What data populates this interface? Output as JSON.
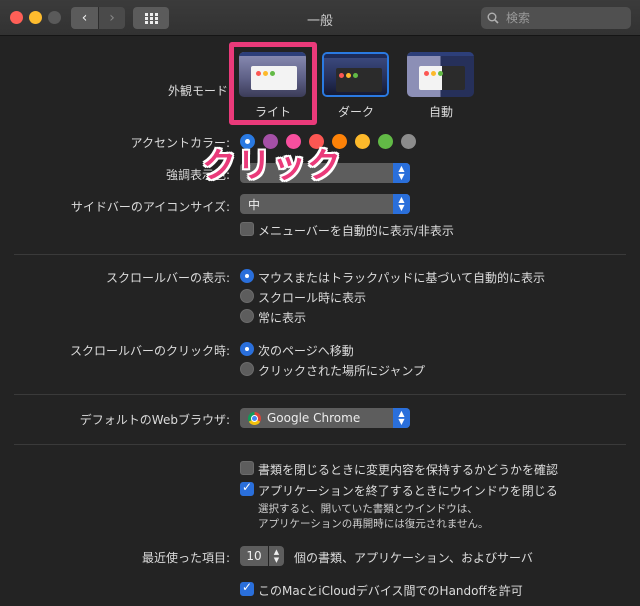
{
  "window": {
    "title": "一般"
  },
  "search": {
    "placeholder": "検索"
  },
  "appearance": {
    "label": "外観モード",
    "options": [
      {
        "label": "ライト",
        "selected": false
      },
      {
        "label": "ダーク",
        "selected": true
      },
      {
        "label": "自動",
        "selected": false
      }
    ]
  },
  "accent": {
    "label": "アクセントカラー:",
    "colors": [
      "#2a7ae2",
      "#a550a7",
      "#f74f9e",
      "#fc5753",
      "#fd8208",
      "#fdb92b",
      "#62ba46",
      "#8c8c8c"
    ],
    "selected_index": 0
  },
  "annotation": {
    "text": "クリック",
    "color": "#ea3a7a"
  },
  "highlight": {
    "label": "強調表示色:",
    "value": ""
  },
  "sidebar_icon": {
    "label": "サイドバーのアイコンサイズ:",
    "value": "中"
  },
  "menubar": {
    "label": "メニューバーを自動的に表示/非表示",
    "checked": false
  },
  "scrollbars": {
    "label": "スクロールバーの表示:",
    "options": [
      {
        "label": "マウスまたはトラックパッドに基づいて自動的に表示",
        "selected": true
      },
      {
        "label": "スクロール時に表示",
        "selected": false
      },
      {
        "label": "常に表示",
        "selected": false
      }
    ]
  },
  "scroll_click": {
    "label": "スクロールバーのクリック時:",
    "options": [
      {
        "label": "次のページへ移動",
        "selected": true
      },
      {
        "label": "クリックされた場所にジャンプ",
        "selected": false
      }
    ]
  },
  "browser": {
    "label": "デフォルトのWebブラウザ:",
    "value": "Google Chrome"
  },
  "docs": {
    "ask_keep": {
      "label": "書類を閉じるときに変更内容を保持するかどうかを確認",
      "checked": false
    },
    "close_windows": {
      "label": "アプリケーションを終了するときにウインドウを閉じる",
      "checked": true
    },
    "note_line1": "選択すると、開いていた書類とウインドウは、",
    "note_line2": "アプリケーションの再開時には復元されません。"
  },
  "recent": {
    "label": "最近使った項目:",
    "value": "10",
    "suffix": "個の書類、アプリケーション、およびサーバ"
  },
  "handoff": {
    "label": "このMacとiCloudデバイス間でのHandoffを許可",
    "checked": true
  }
}
